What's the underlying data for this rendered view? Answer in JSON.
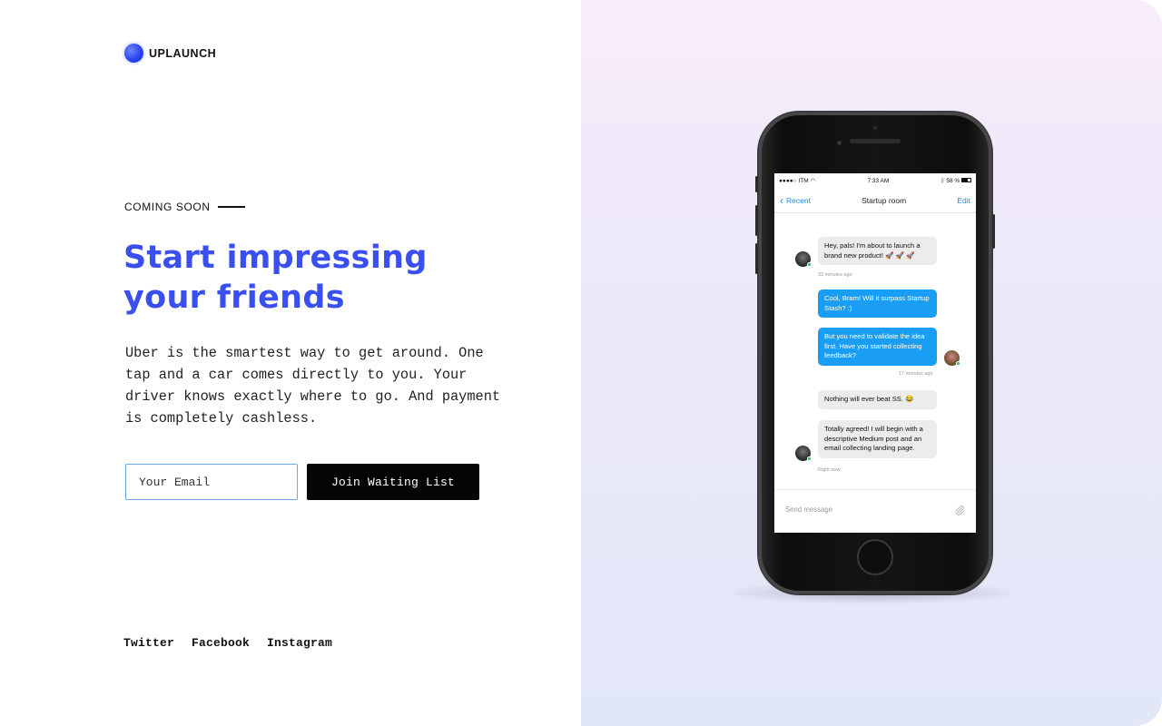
{
  "brand": {
    "name": "UPLAUNCH"
  },
  "hero": {
    "eyebrow": "COMING SOON",
    "headline_line1": "Start impressing",
    "headline_line2": "your friends",
    "description": "Uber is the smartest way to get around. One tap and a car comes directly to you. Your driver knows exactly where to go. And payment is completely cashless."
  },
  "signup": {
    "email_placeholder": "Your Email",
    "button_label": "Join Waiting List"
  },
  "social": [
    "Twitter",
    "Facebook",
    "Instagram"
  ],
  "phone": {
    "status": {
      "carrier": "ITM",
      "time": "7:33 AM",
      "battery": "58 %"
    },
    "nav": {
      "back": "Recent",
      "title": "Startup room",
      "edit": "Edit"
    },
    "messages": [
      {
        "from": "them",
        "text": "Hey, pals! I'm about to launch a brand new product! 🚀 🚀 🚀"
      },
      {
        "timestamp": "33 minutes ago"
      },
      {
        "from": "me",
        "text": "Cool, Bram! Will it surpass Startup Stash? :)"
      },
      {
        "from": "me",
        "text": "But you need to validate the idea first. Have you started collecting feedback?"
      },
      {
        "timestamp": "17 minutes ago"
      },
      {
        "from": "them",
        "text": "Nothing will ever beat SS. 😂"
      },
      {
        "from": "them",
        "text": "Totally agreed! I will begin with a descriptive Medium post and an email collecting landing page."
      },
      {
        "timestamp": "Right now"
      }
    ],
    "composer_placeholder": "Send message"
  },
  "colors": {
    "accent": "#3a4ff0",
    "button_bg": "#050505",
    "bubble_out": "#1a9ef5",
    "bubble_in": "#ececec",
    "ios_blue": "#1a8cf0"
  }
}
